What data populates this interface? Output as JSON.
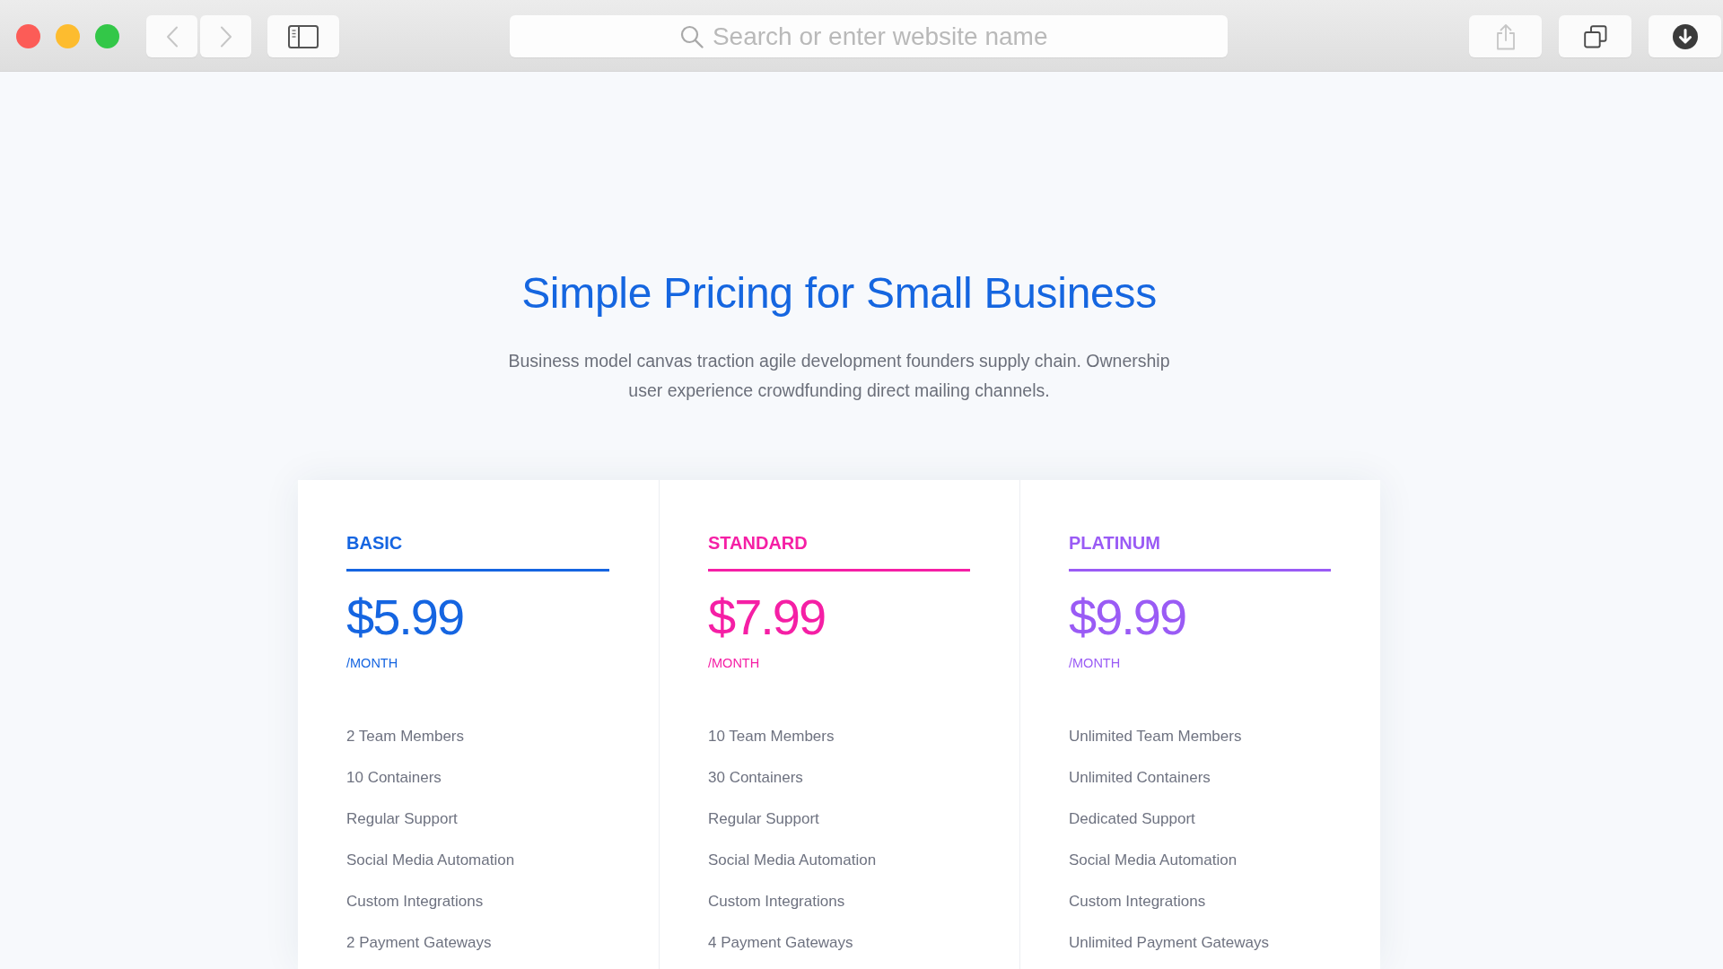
{
  "toolbar": {
    "back": {
      "disabled": true
    },
    "forward": {
      "disabled": true
    },
    "address_bar": {
      "placeholder": "Search or enter website name"
    },
    "share": {
      "disabled": true
    }
  },
  "hero": {
    "title": "Simple Pricing for Small Business",
    "subtitle": "Business model canvas traction agile development founders supply chain. Ownership user experience crowdfunding direct mailing channels."
  },
  "plans": [
    {
      "name": "BASIC",
      "color": "#1565e1",
      "price": "$5.99",
      "period": "/MONTH",
      "features": [
        "2 Team Members",
        "10 Containers",
        "Regular Support",
        "Social Media Automation",
        "Custom Integrations",
        "2 Payment Gateways"
      ]
    },
    {
      "name": "STANDARD",
      "color": "#f51fa5",
      "price": "$7.99",
      "period": "/MONTH",
      "features": [
        "10 Team Members",
        "30 Containers",
        "Regular Support",
        "Social Media Automation",
        "Custom Integrations",
        "4 Payment Gateways"
      ]
    },
    {
      "name": "PLATINUM",
      "color": "#9a5bf5",
      "price": "$9.99",
      "period": "/MONTH",
      "features": [
        "Unlimited Team Members",
        "Unlimited Containers",
        "Dedicated Support",
        "Social Media Automation",
        "Custom Integrations",
        "Unlimited Payment Gateways"
      ]
    }
  ]
}
